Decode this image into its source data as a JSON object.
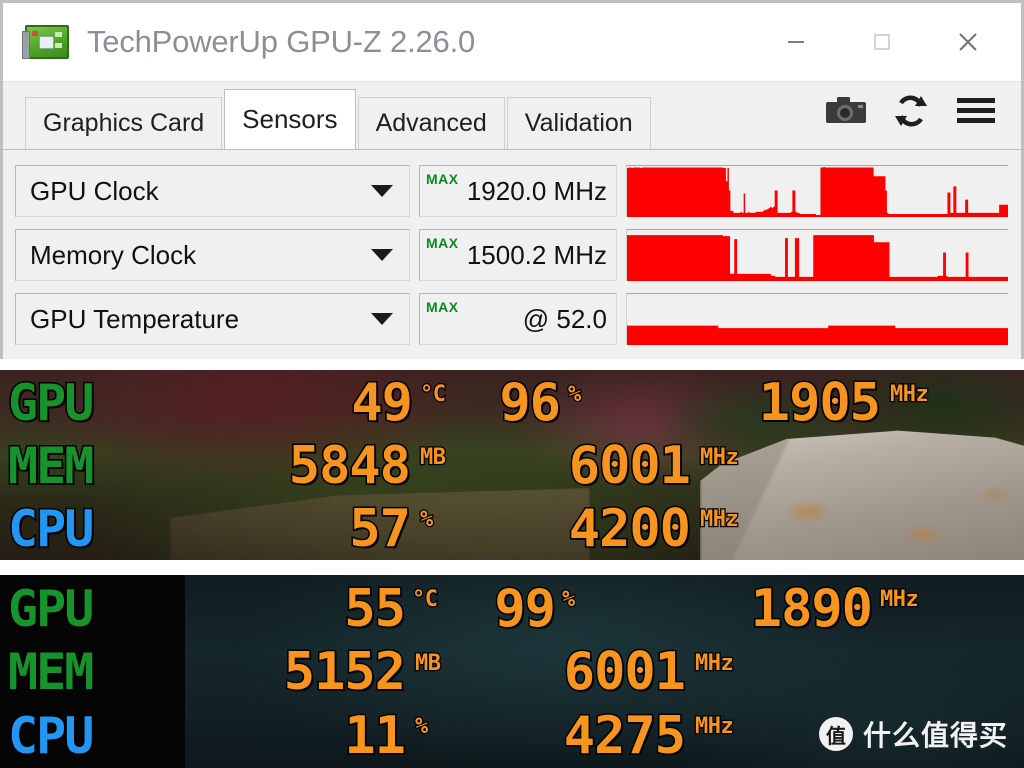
{
  "window": {
    "title": "TechPowerUp GPU-Z 2.26.0",
    "app_icon": "graphics-card-icon",
    "controls": {
      "minimize": "minimize-icon",
      "maximize": "maximize-icon",
      "close": "close-icon"
    }
  },
  "tabs": [
    {
      "label": "Graphics Card",
      "active": false
    },
    {
      "label": "Sensors",
      "active": true
    },
    {
      "label": "Advanced",
      "active": false
    },
    {
      "label": "Validation",
      "active": false
    }
  ],
  "toolbar": {
    "screenshot": "camera-icon",
    "refresh": "refresh-icon",
    "menu": "hamburger-menu-icon"
  },
  "sensors": {
    "max_tag": "MAX",
    "rows": [
      {
        "name": "GPU Clock",
        "value": "1920.0 MHz"
      },
      {
        "name": "Memory Clock",
        "value": "1500.2 MHz"
      },
      {
        "name": "GPU Temperature",
        "value": "@ 52.0"
      }
    ],
    "graph_color": "#ff0000"
  },
  "chart_data": [
    {
      "type": "area",
      "title": "GPU Clock",
      "ylabel": "MHz",
      "series": [
        {
          "name": "GPU Clock",
          "values": [
            96,
            97,
            97,
            96,
            97,
            97,
            97,
            97,
            97,
            96,
            97,
            97,
            97,
            97,
            97,
            97,
            97,
            97,
            97,
            97,
            97,
            97,
            97,
            97,
            97,
            97,
            97,
            97,
            97,
            97,
            97,
            97,
            97,
            97,
            97,
            97,
            97,
            97,
            97,
            97,
            97,
            97,
            97,
            97,
            97,
            97,
            97,
            97,
            97,
            97,
            97,
            97,
            97,
            97,
            97,
            97,
            97,
            97,
            97,
            97,
            97,
            97,
            97,
            97,
            97,
            96,
            96,
            70,
            96,
            52,
            12,
            12,
            8,
            8,
            8,
            8,
            8,
            10,
            8,
            46,
            8,
            8,
            10,
            8,
            8,
            8,
            8,
            10,
            10,
            10,
            10,
            10,
            12,
            14,
            14,
            16,
            18,
            20,
            18,
            20,
            52,
            52,
            8,
            8,
            8,
            8,
            8,
            8,
            8,
            8,
            8,
            10,
            52,
            52,
            10,
            8,
            8,
            6,
            6,
            6,
            6,
            6,
            6,
            6,
            6,
            6,
            6,
            6,
            4,
            4,
            4,
            97,
            97,
            98,
            97,
            97,
            97,
            97,
            97,
            97,
            97,
            97,
            97,
            97,
            97,
            97,
            97,
            97,
            97,
            97,
            97,
            97,
            97,
            97,
            97,
            97,
            97,
            97,
            97,
            97,
            97,
            97,
            97,
            97,
            97,
            97,
            97,
            80,
            80,
            80,
            80,
            80,
            80,
            80,
            80,
            52,
            8,
            6,
            6,
            6,
            6,
            6,
            6,
            6,
            6,
            6,
            6,
            6,
            6,
            6,
            6,
            6,
            6,
            6,
            6,
            6,
            6,
            6,
            6,
            6,
            6,
            6,
            6,
            6,
            6,
            6,
            6,
            6,
            6,
            6,
            6,
            6,
            6,
            6,
            6,
            6,
            6,
            48,
            48,
            8,
            8,
            60,
            60,
            8,
            8,
            8,
            8,
            8,
            8,
            34,
            34,
            8,
            8,
            8,
            8,
            8,
            8,
            8,
            8,
            8,
            8,
            8,
            8,
            8,
            8,
            8,
            8,
            8,
            8,
            8,
            8,
            8,
            24,
            24,
            24,
            24,
            24,
            24
          ]
        }
      ]
    },
    {
      "type": "area",
      "title": "Memory Clock",
      "ylabel": "MHz",
      "series": [
        {
          "name": "Memory Clock",
          "values": [
            90,
            90,
            90,
            90,
            90,
            90,
            90,
            90,
            90,
            90,
            90,
            90,
            90,
            90,
            90,
            90,
            90,
            90,
            90,
            90,
            90,
            90,
            90,
            90,
            90,
            90,
            90,
            90,
            90,
            90,
            90,
            90,
            90,
            90,
            90,
            90,
            90,
            90,
            90,
            90,
            90,
            90,
            90,
            90,
            90,
            90,
            90,
            90,
            90,
            90,
            90,
            90,
            90,
            90,
            90,
            90,
            90,
            90,
            90,
            90,
            90,
            90,
            90,
            90,
            90,
            90,
            90,
            90,
            88,
            88,
            88,
            88,
            88,
            14,
            14,
            14,
            82,
            82,
            14,
            14,
            14,
            14,
            14,
            14,
            14,
            14,
            14,
            14,
            14,
            14,
            14,
            14,
            14,
            14,
            14,
            14,
            14,
            14,
            14,
            14,
            14,
            14,
            10,
            10,
            10,
            8,
            8,
            8,
            8,
            8,
            8,
            8,
            84,
            84,
            8,
            8,
            8,
            8,
            8,
            84,
            84,
            84,
            8,
            8,
            8,
            8,
            8,
            8,
            8,
            8,
            8,
            8,
            90,
            90,
            90,
            90,
            90,
            90,
            90,
            90,
            90,
            90,
            90,
            90,
            90,
            90,
            90,
            90,
            90,
            90,
            90,
            90,
            90,
            90,
            90,
            90,
            90,
            90,
            90,
            90,
            90,
            90,
            90,
            90,
            90,
            90,
            90,
            90,
            90,
            90,
            90,
            90,
            90,
            90,
            90,
            76,
            76,
            76,
            76,
            76,
            76,
            76,
            76,
            76,
            76,
            76,
            8,
            8,
            8,
            8,
            8,
            8,
            8,
            8,
            8,
            8,
            8,
            8,
            8,
            8,
            8,
            8,
            8,
            8,
            8,
            8,
            8,
            8,
            8,
            8,
            8,
            8,
            8,
            8,
            8,
            8,
            8,
            8,
            8,
            8,
            10,
            10,
            10,
            10,
            56,
            56,
            10,
            8,
            8,
            8,
            8,
            8,
            8,
            8,
            8,
            8,
            8,
            8,
            8,
            8,
            56,
            56,
            8,
            8,
            8,
            8,
            8,
            8,
            8,
            8,
            8,
            8,
            8,
            8,
            8,
            8,
            8,
            8,
            8,
            8,
            8,
            8,
            8,
            8,
            8,
            8,
            8,
            8,
            8,
            8
          ]
        }
      ]
    },
    {
      "type": "area",
      "title": "GPU Temperature",
      "ylabel": "°C",
      "series": [
        {
          "name": "GPU Temperature",
          "values": [
            38,
            38,
            38,
            38,
            38,
            38,
            38,
            38,
            38,
            38,
            38,
            38,
            38,
            38,
            38,
            38,
            38,
            38,
            38,
            38,
            38,
            38,
            38,
            38,
            38,
            38,
            38,
            38,
            38,
            38,
            38,
            38,
            38,
            38,
            38,
            38,
            38,
            38,
            38,
            38,
            38,
            38,
            38,
            38,
            38,
            38,
            38,
            38,
            38,
            38,
            38,
            38,
            38,
            38,
            38,
            38,
            38,
            38,
            38,
            38,
            38,
            38,
            38,
            38,
            33,
            33,
            33,
            33,
            33,
            33,
            33,
            33,
            33,
            33,
            33,
            33,
            33,
            33,
            33,
            33,
            33,
            33,
            33,
            33,
            33,
            33,
            33,
            33,
            33,
            33,
            33,
            33,
            33,
            33,
            33,
            33,
            33,
            33,
            33,
            33,
            33,
            33,
            33,
            33,
            33,
            33,
            33,
            33,
            33,
            33,
            33,
            33,
            33,
            33,
            33,
            33,
            33,
            33,
            33,
            33,
            33,
            33,
            33,
            33,
            33,
            33,
            33,
            33,
            33,
            33,
            33,
            33,
            33,
            33,
            33,
            33,
            33,
            33,
            33,
            33,
            33,
            38,
            38,
            38,
            38,
            38,
            38,
            38,
            38,
            38,
            38,
            38,
            38,
            38,
            38,
            38,
            38,
            38,
            38,
            38,
            38,
            38,
            38,
            38,
            38,
            38,
            38,
            38,
            38,
            38,
            38,
            38,
            38,
            38,
            38,
            38,
            38,
            38,
            38,
            38,
            38,
            38,
            38,
            38,
            38,
            38,
            38,
            38,
            33,
            33,
            33,
            33,
            33,
            33,
            33,
            33,
            33,
            33,
            33,
            33,
            33,
            33,
            33,
            33,
            33,
            33,
            33,
            33,
            33,
            33,
            33,
            33,
            33,
            33,
            33,
            33,
            33,
            33,
            33,
            33,
            33,
            33,
            33,
            33,
            33,
            33,
            33,
            33,
            33,
            33,
            33,
            33,
            33,
            33,
            33,
            33,
            33,
            33,
            33,
            33,
            33,
            33,
            33,
            33,
            33,
            33,
            33,
            33,
            33,
            33,
            33,
            33,
            33,
            33,
            33,
            33,
            33,
            33,
            33,
            33,
            33,
            33,
            33,
            33,
            33,
            33,
            33
          ]
        }
      ]
    }
  ],
  "osd_panels": [
    {
      "id": "osd-top",
      "background": "game-scene-forest",
      "rows": [
        {
          "label": "GPU",
          "label_color": "#17932c",
          "fields": [
            {
              "value": "49",
              "unit": "°C"
            },
            {
              "value": "96",
              "unit": "%"
            },
            {
              "value": "1905",
              "unit": "MHz"
            }
          ]
        },
        {
          "label": "MEM",
          "label_color": "#17932c",
          "fields": [
            {
              "value": "5848",
              "unit": "MB"
            },
            {
              "value": "6001",
              "unit": "MHz"
            }
          ]
        },
        {
          "label": "CPU",
          "label_color": "#2196f3",
          "fields": [
            {
              "value": "57",
              "unit": "%"
            },
            {
              "value": "4200",
              "unit": "MHz"
            }
          ]
        }
      ]
    },
    {
      "id": "osd-bottom",
      "background": "game-scene-dark-teal",
      "rows": [
        {
          "label": "GPU",
          "label_color": "#17932c",
          "fields": [
            {
              "value": "55",
              "unit": "°C"
            },
            {
              "value": "99",
              "unit": "%"
            },
            {
              "value": "1890",
              "unit": "MHz"
            }
          ]
        },
        {
          "label": "MEM",
          "label_color": "#17932c",
          "fields": [
            {
              "value": "5152",
              "unit": "MB"
            },
            {
              "value": "6001",
              "unit": "MHz"
            }
          ]
        },
        {
          "label": "CPU",
          "label_color": "#2196f3",
          "fields": [
            {
              "value": "11",
              "unit": "%"
            },
            {
              "value": "4275",
              "unit": "MHz"
            }
          ]
        }
      ]
    }
  ],
  "watermark": {
    "badge": "值",
    "text": "什么值得买"
  },
  "colors": {
    "osd_value": "#f7941d",
    "osd_label_green": "#17932c",
    "osd_label_blue": "#2196f3",
    "graph_red": "#ff0000",
    "max_tag_green": "#0a8b22"
  }
}
